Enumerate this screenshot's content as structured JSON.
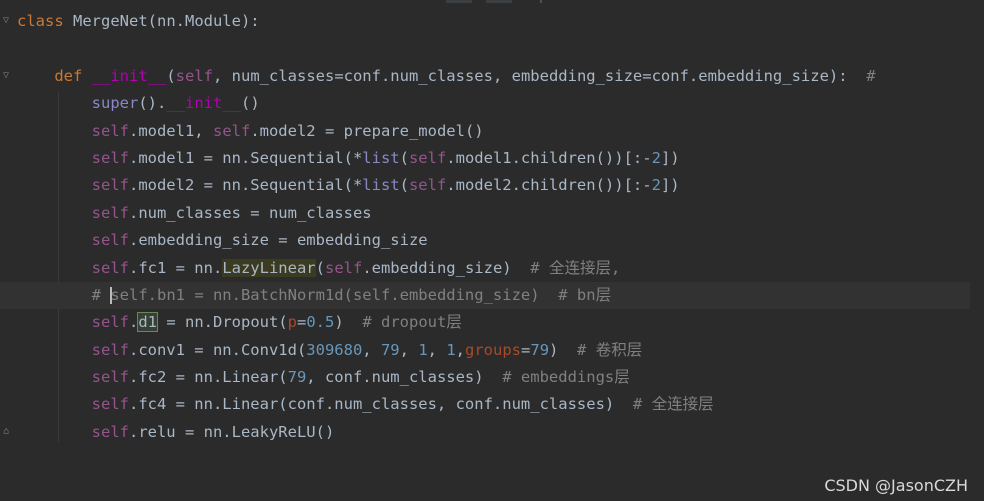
{
  "editor": {
    "lines": [
      {
        "tokens": [
          {
            "t": "class",
            "c": "kw"
          },
          {
            "t": " MergeNet(nn.Module):",
            "c": "plain"
          }
        ],
        "fold": "open"
      },
      {
        "tokens": []
      },
      {
        "tokens": [
          {
            "t": "    ",
            "c": "plain"
          },
          {
            "t": "def",
            "c": "kw"
          },
          {
            "t": " ",
            "c": "plain"
          },
          {
            "t": "__init__",
            "c": "magic"
          },
          {
            "t": "(",
            "c": "plain"
          },
          {
            "t": "self",
            "c": "self"
          },
          {
            "t": ", num_classes=conf.num_classes, embedding_size=conf.embedding_size):  ",
            "c": "plain"
          },
          {
            "t": "#",
            "c": "cmt"
          }
        ],
        "fold": "open"
      },
      {
        "tokens": [
          {
            "t": "        ",
            "c": "plain"
          },
          {
            "t": "super",
            "c": "builtin"
          },
          {
            "t": "().",
            "c": "plain"
          },
          {
            "t": "__init__",
            "c": "magic"
          },
          {
            "t": "()",
            "c": "plain"
          }
        ]
      },
      {
        "tokens": [
          {
            "t": "        ",
            "c": "plain"
          },
          {
            "t": "self",
            "c": "self"
          },
          {
            "t": ".model1, ",
            "c": "plain"
          },
          {
            "t": "self",
            "c": "self"
          },
          {
            "t": ".model2 = prepare_model()",
            "c": "plain"
          }
        ]
      },
      {
        "tokens": [
          {
            "t": "        ",
            "c": "plain"
          },
          {
            "t": "self",
            "c": "self"
          },
          {
            "t": ".model1 = nn.Sequential(*",
            "c": "plain"
          },
          {
            "t": "list",
            "c": "builtin"
          },
          {
            "t": "(",
            "c": "plain"
          },
          {
            "t": "self",
            "c": "self"
          },
          {
            "t": ".model1.children())[:-",
            "c": "plain"
          },
          {
            "t": "2",
            "c": "num"
          },
          {
            "t": "])",
            "c": "plain"
          }
        ]
      },
      {
        "tokens": [
          {
            "t": "        ",
            "c": "plain"
          },
          {
            "t": "self",
            "c": "self"
          },
          {
            "t": ".model2 = nn.Sequential(*",
            "c": "plain"
          },
          {
            "t": "list",
            "c": "builtin"
          },
          {
            "t": "(",
            "c": "plain"
          },
          {
            "t": "self",
            "c": "self"
          },
          {
            "t": ".model2.children())[:-",
            "c": "plain"
          },
          {
            "t": "2",
            "c": "num"
          },
          {
            "t": "])",
            "c": "plain"
          }
        ]
      },
      {
        "tokens": [
          {
            "t": "        ",
            "c": "plain"
          },
          {
            "t": "self",
            "c": "self"
          },
          {
            "t": ".num_classes = num_classes",
            "c": "plain"
          }
        ]
      },
      {
        "tokens": [
          {
            "t": "        ",
            "c": "plain"
          },
          {
            "t": "self",
            "c": "self"
          },
          {
            "t": ".embedding_size = embedding_size",
            "c": "plain"
          }
        ]
      },
      {
        "tokens": [
          {
            "t": "        ",
            "c": "plain"
          },
          {
            "t": "self",
            "c": "self"
          },
          {
            "t": ".fc1 = nn.",
            "c": "plain"
          },
          {
            "t": "LazyLinear",
            "c": "hl-olive"
          },
          {
            "t": "(",
            "c": "plain"
          },
          {
            "t": "self",
            "c": "self"
          },
          {
            "t": ".embedding_size)  ",
            "c": "plain"
          },
          {
            "t": "# 全连接层,",
            "c": "cmt"
          }
        ]
      },
      {
        "tokens": [
          {
            "t": "        ",
            "c": "plain"
          },
          {
            "t": "# ",
            "c": "cmt"
          },
          {
            "t": "",
            "c": "caret"
          },
          {
            "t": "self.bn1 = nn.BatchNorm1d(self.embedding_size)  # bn层",
            "c": "cmt"
          }
        ],
        "current": true
      },
      {
        "tokens": [
          {
            "t": "        ",
            "c": "plain"
          },
          {
            "t": "self",
            "c": "self"
          },
          {
            "t": ".",
            "c": "plain"
          },
          {
            "t": "d1",
            "c": "hl-green"
          },
          {
            "t": " = nn.Dropout(",
            "c": "plain"
          },
          {
            "t": "p",
            "c": "param"
          },
          {
            "t": "=",
            "c": "plain"
          },
          {
            "t": "0.5",
            "c": "num"
          },
          {
            "t": ")  ",
            "c": "plain"
          },
          {
            "t": "# dropout层",
            "c": "cmt"
          }
        ]
      },
      {
        "tokens": [
          {
            "t": "        ",
            "c": "plain"
          },
          {
            "t": "self",
            "c": "self"
          },
          {
            "t": ".conv1 = nn.Conv1d(",
            "c": "plain"
          },
          {
            "t": "309680",
            "c": "num"
          },
          {
            "t": ", ",
            "c": "plain"
          },
          {
            "t": "79",
            "c": "num"
          },
          {
            "t": ", ",
            "c": "plain"
          },
          {
            "t": "1",
            "c": "num"
          },
          {
            "t": ", ",
            "c": "plain"
          },
          {
            "t": "1",
            "c": "num"
          },
          {
            "t": ",",
            "c": "plain"
          },
          {
            "t": "groups",
            "c": "param"
          },
          {
            "t": "=",
            "c": "plain"
          },
          {
            "t": "79",
            "c": "num"
          },
          {
            "t": ")  ",
            "c": "plain"
          },
          {
            "t": "# 卷积层",
            "c": "cmt"
          }
        ]
      },
      {
        "tokens": [
          {
            "t": "        ",
            "c": "plain"
          },
          {
            "t": "self",
            "c": "self"
          },
          {
            "t": ".fc2 = nn.Linear(",
            "c": "plain"
          },
          {
            "t": "79",
            "c": "num"
          },
          {
            "t": ", conf.num_classes)  ",
            "c": "plain"
          },
          {
            "t": "# embeddings层",
            "c": "cmt"
          }
        ]
      },
      {
        "tokens": [
          {
            "t": "        ",
            "c": "plain"
          },
          {
            "t": "self",
            "c": "self"
          },
          {
            "t": ".fc4 = nn.Linear(conf.num_classes, conf.num_classes)  ",
            "c": "plain"
          },
          {
            "t": "# 全连接层",
            "c": "cmt"
          }
        ]
      },
      {
        "tokens": [
          {
            "t": "        ",
            "c": "plain"
          },
          {
            "t": "self",
            "c": "self"
          },
          {
            "t": ".relu = nn.LeakyReLU()",
            "c": "plain"
          }
        ],
        "fold": "end"
      }
    ]
  },
  "watermark": "CSDN @JasonCZH",
  "colors": {
    "background": "#2b2b2b",
    "keyword": "#cc7832",
    "self": "#94558d",
    "magic": "#b200b2",
    "number": "#6897bb",
    "comment": "#808080",
    "plain": "#a9b7c6"
  }
}
